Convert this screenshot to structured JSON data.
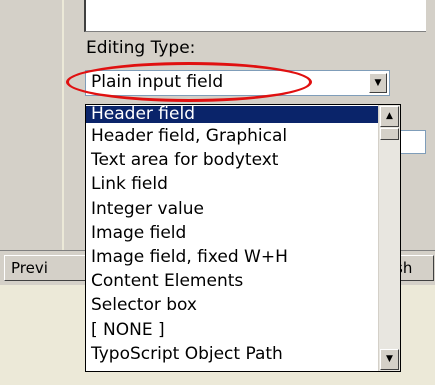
{
  "form": {
    "editing_type_label": "Editing Type:",
    "selected_value": "Plain input field"
  },
  "dropdown": {
    "options": [
      "Header field",
      "Header field, Graphical",
      "Text area for bodytext",
      "Link field",
      "Integer value",
      "Image field",
      "Image field, fixed W+H",
      "Content Elements",
      "Selector box",
      "[ NONE ]",
      "TypoScript Object Path"
    ],
    "highlighted_index": 0
  },
  "bottom_bar": {
    "left_button_label": "Previ",
    "right_button_label": "sh"
  },
  "icons": {
    "select_arrow": "chevron-down-icon",
    "scroll_up": "arrow-up-icon",
    "scroll_down": "arrow-down-icon"
  },
  "colors": {
    "highlight": "#0a246a",
    "annotation": "#e01010",
    "panel": "#d4d0c8"
  }
}
